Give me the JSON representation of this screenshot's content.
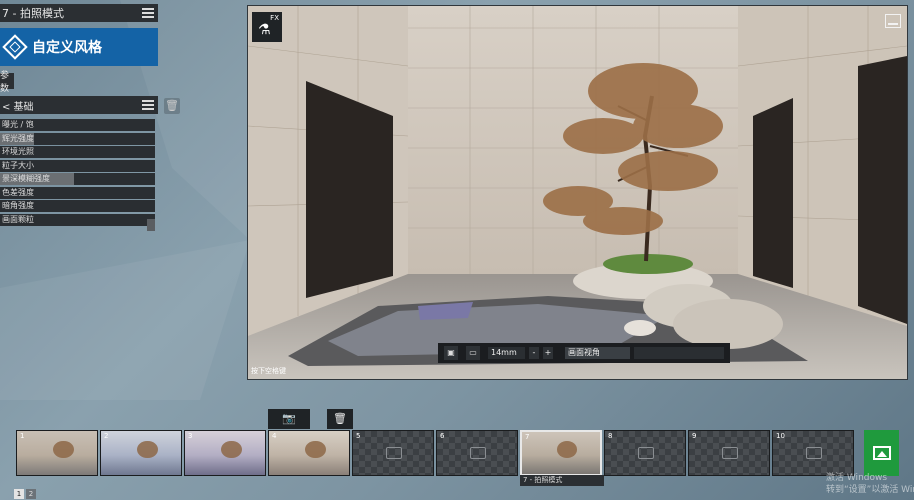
{
  "panel": {
    "mode_title": "7 - 拍照模式",
    "style_label": "自定义风格",
    "param_tag": "参数",
    "section_title": "< 基础",
    "params": [
      {
        "label": "曝光 / 饱",
        "fill": 0.0
      },
      {
        "label": "辉光强度",
        "fill": 0.22
      },
      {
        "label": "环境光照",
        "fill": 0.0
      },
      {
        "label": "粒子大小",
        "fill": 0.0
      },
      {
        "label": "景深模糊强度",
        "fill": 0.48
      },
      {
        "label": "色差强度",
        "fill": 0.0
      },
      {
        "label": "暗角强度",
        "fill": 0.0
      },
      {
        "label": "画面颗粒",
        "fill": 0.0
      }
    ]
  },
  "viewport": {
    "fx_label": "FX",
    "camera": {
      "lens": "14mm",
      "view_name": "画面视角",
      "inc": "+",
      "dec": "-"
    },
    "caption": "按下空格键"
  },
  "toolbar": {
    "camera_icon": "camera-icon",
    "delete_icon": "trash-icon"
  },
  "thumbnails": [
    {
      "num": "1",
      "state": "filled"
    },
    {
      "num": "2",
      "state": "filled"
    },
    {
      "num": "3",
      "state": "filled"
    },
    {
      "num": "4",
      "state": "filled"
    },
    {
      "num": "5",
      "state": "empty"
    },
    {
      "num": "6",
      "state": "empty"
    },
    {
      "num": "7",
      "state": "selected"
    },
    {
      "num": "8",
      "state": "empty"
    },
    {
      "num": "9",
      "state": "empty"
    },
    {
      "num": "10",
      "state": "empty"
    }
  ],
  "selected_label": "7 - 拍照模式",
  "watermark": {
    "line1": "激活 Windows",
    "line2": "转到“设置”以激活 Windows。"
  },
  "pager": [
    "1",
    "2"
  ],
  "colors": {
    "accent": "#1463a6",
    "render": "#1f9a3d",
    "panel": "#2b2f33"
  }
}
